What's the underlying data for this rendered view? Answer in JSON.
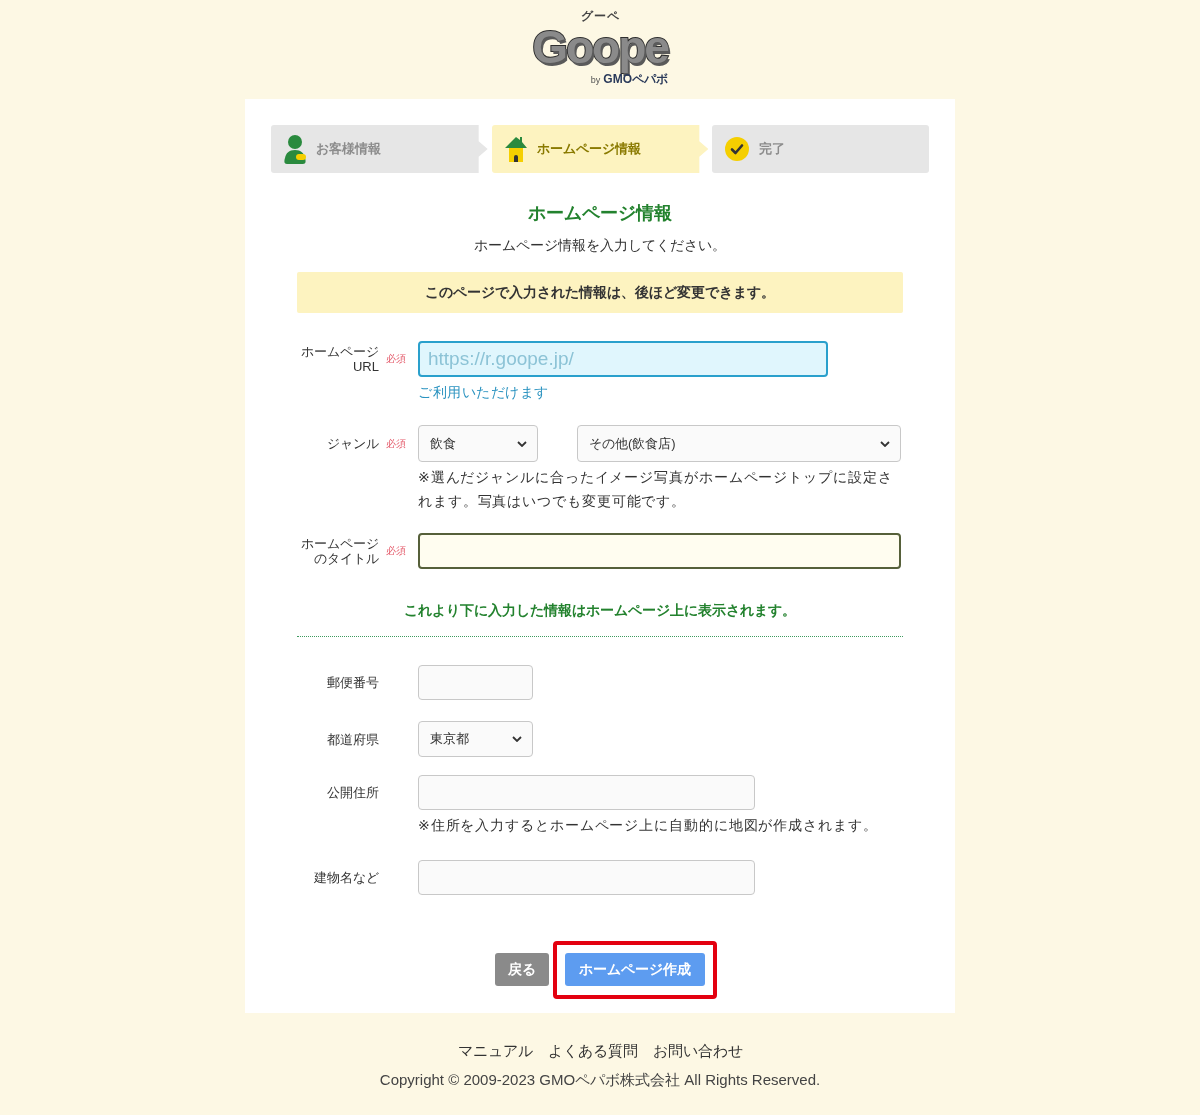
{
  "header": {
    "logo": {
      "kana": "グーペ",
      "wordmark": "Goope",
      "byline": "by",
      "company": "GMOペパボ"
    }
  },
  "steps": [
    {
      "label": "お客様情報",
      "kind": "person",
      "selected": false
    },
    {
      "label": "ホームページ情報",
      "kind": "house",
      "selected": true
    },
    {
      "label": "完了",
      "kind": "check",
      "selected": false
    }
  ],
  "heading": "ホームページ情報",
  "subtitle": "ホームページ情報を入力してください。",
  "notice": "このページで入力された情報は、後ほど変更できます。",
  "site_fields": [
    {
      "kind": "url",
      "label": [
        "ホームページ",
        "URL"
      ],
      "required": "必須",
      "placeholder": "https://r.goope.jp/",
      "status": "ご利用いただけます"
    },
    {
      "kind": "select-pair",
      "label": "ジャンル",
      "required": "必須",
      "selects": [
        {
          "value": "飲食"
        },
        {
          "value": "その他(飲食店)"
        }
      ],
      "note": "※選んだジャンルに合ったイメージ写真がホームページトップに設定されます。写真はいつでも変更可能です。"
    },
    {
      "kind": "title",
      "label": [
        "ホームページ",
        "のタイトル"
      ],
      "required": "必須"
    }
  ],
  "public_notice": "これより下に入力した情報はホームページ上に表示されます。",
  "public_fields": [
    {
      "kind": "short",
      "label": "郵便番号"
    },
    {
      "kind": "select",
      "label": "都道府県",
      "value": "東京都"
    },
    {
      "kind": "wide",
      "label": "公開住所",
      "note": "※住所を入力するとホームページ上に自動的に地図が作成されます。"
    },
    {
      "kind": "wide",
      "label": "建物名など"
    }
  ],
  "buttons": [
    {
      "label": "戻る",
      "kind": "back",
      "highlighted": false
    },
    {
      "label": "ホームページ作成",
      "kind": "submit",
      "highlighted": true
    }
  ],
  "footer": {
    "links": [
      "マニュアル",
      "よくある質問",
      "お問い合わせ"
    ],
    "copyright": "Copyright © 2009-2023 GMOペパボ株式会社 All Rights Reserved."
  }
}
